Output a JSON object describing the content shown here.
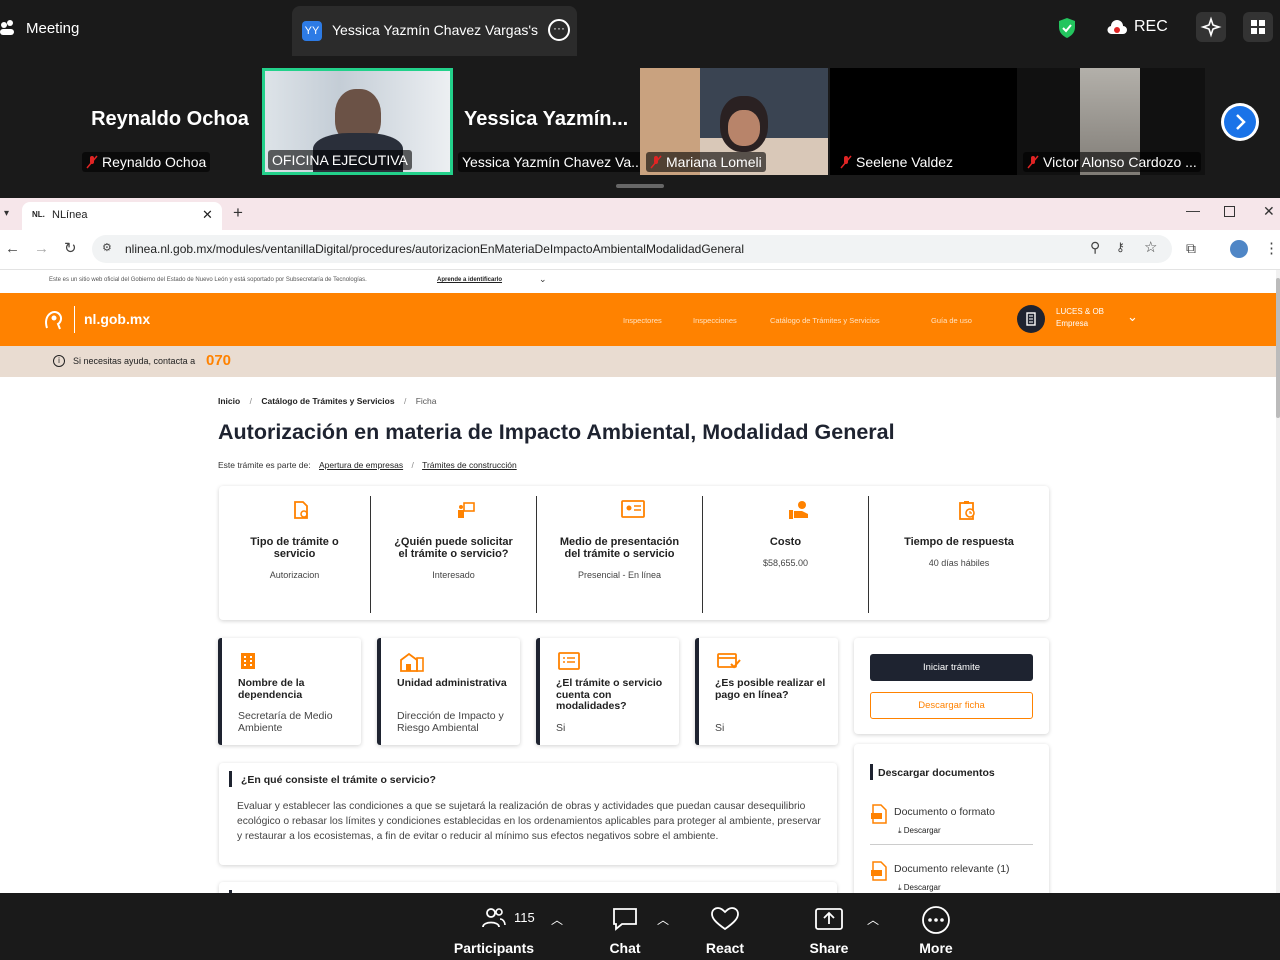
{
  "zoom": {
    "meeting_label": "Meeting",
    "share_tab": {
      "initials": "YY",
      "title": "Yessica Yazmín Chavez Vargas's sc"
    },
    "rec_label": "REC",
    "participants": [
      {
        "big": "Reynaldo Ochoa",
        "label": "Reynaldo Ochoa",
        "muted": true
      },
      {
        "big": "",
        "label": "OFICINA EJECUTIVA",
        "muted": false,
        "active": true
      },
      {
        "big": "Yessica Yazmín...",
        "label": "Yessica Yazmín Chavez Va...",
        "muted": false
      },
      {
        "big": "",
        "label": "Mariana Lomeli",
        "muted": true
      },
      {
        "big": "",
        "label": "Seelene Valdez",
        "muted": true
      },
      {
        "big": "",
        "label": "Victor Alonso Cardozo ...",
        "muted": true
      }
    ],
    "bottom": {
      "participants_label": "Participants",
      "participants_count": "115",
      "chat_label": "Chat",
      "react_label": "React",
      "share_label": "Share",
      "more_label": "More"
    }
  },
  "browser": {
    "tab_title": "NLínea",
    "tab_favicon": "NL.",
    "url": "nlinea.nl.gob.mx/modules/ventanillaDigital/procedures/autorizacionEnMateriaDeImpactoAmbientalModalidadGeneral"
  },
  "site": {
    "gov_notice": "Este es un sitio web oficial del Gobierno del Estado de Nuevo León y está soportado por Subsecretaría de Tecnologías.",
    "gov_notice_link": "Aprende a identificarlo",
    "logo_text": "nl.gob.mx",
    "nav": [
      "Inspectores",
      "Inspecciones",
      "Catálogo de Trámites y Servicios",
      "Guía de uso"
    ],
    "user": {
      "name": "LUCES & OB",
      "role": "Empresa"
    },
    "help_text": "Si necesitas ayuda, contacta a",
    "help_number": "070",
    "breadcrumb": [
      "Inicio",
      "Catálogo de Trámites y Servicios",
      "Ficha"
    ],
    "title": "Autorización en materia de Impacto Ambiental, Modalidad General",
    "part_of_label": "Este trámite es parte de:",
    "part_of_links": [
      "Apertura de empresas",
      "Trámites de construcción"
    ],
    "info": [
      {
        "title": "Tipo de trámite o servicio",
        "value": "Autorizacion",
        "icon": "document-icon"
      },
      {
        "title": "¿Quién puede solicitar el trámite o servicio?",
        "value": "Interesado",
        "icon": "presenter-icon"
      },
      {
        "title": "Medio de presentación del trámite o servicio",
        "value": "Presencial - En línea",
        "icon": "id-card-icon"
      },
      {
        "title": "Costo",
        "value": "$58,655.00",
        "icon": "hand-coin-icon"
      },
      {
        "title": "Tiempo de respuesta",
        "value": "40 días hábiles",
        "icon": "clipboard-clock-icon"
      }
    ],
    "meta": [
      {
        "title": "Nombre de la dependencia",
        "value": "Secretaría de Medio Ambiente",
        "icon": "building-icon"
      },
      {
        "title": "Unidad administrativa",
        "value": "Dirección de Impacto y Riesgo Ambiental",
        "icon": "house-icon"
      },
      {
        "title": "¿El trámite o servicio cuenta con modalidades?",
        "value": "Si",
        "icon": "list-icon"
      },
      {
        "title": "¿Es posible realizar el pago en línea?",
        "value": "Si",
        "icon": "payment-icon"
      }
    ],
    "start_button": "Iniciar trámite",
    "download_button": "Descargar ficha",
    "description_title": "¿En qué consiste el trámite o servicio?",
    "description": "Evaluar y establecer las condiciones a que se sujetará la realización de obras y actividades que puedan causar desequilibrio ecológico o rebasar los límites y condiciones establecidas en los ordenamientos aplicables para proteger al ambiente, preservar y restaurar a los ecosistemas, a fin de evitar o reducir al mínimo sus efectos negativos sobre el ambiente.",
    "docs_title": "Descargar documentos",
    "docs": [
      {
        "name": "Documento o formato",
        "action": "Descargar"
      },
      {
        "name": "Documento relevante (1)",
        "action": "Descargar"
      }
    ]
  },
  "colors": {
    "accent": "#ff8200",
    "dark": "#1e2330",
    "zoom_bg": "#1a1a1a",
    "active_tile": "#23d18b"
  }
}
